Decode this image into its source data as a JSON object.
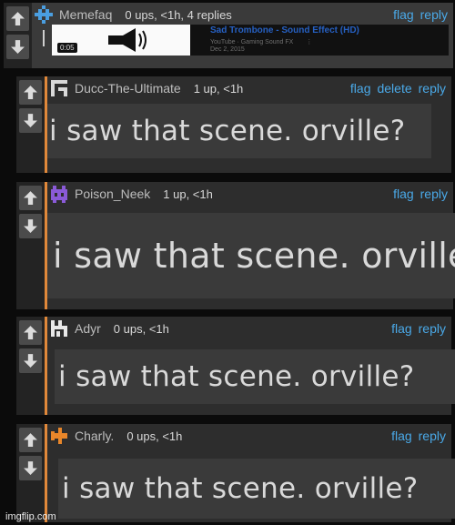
{
  "vote": {
    "up_label": "upvote",
    "down_label": "downvote"
  },
  "comments": [
    {
      "user": "Memefaq",
      "meta": "0 ups, <1h, 4 replies",
      "links": [
        "flag",
        "reply"
      ],
      "avatar_color": "#4a9ee0",
      "embed": {
        "duration": "0:05",
        "title": "Sad Trombone - Sound Effect (HD)",
        "channel": "YouTube · Gaming Sound FX",
        "date": "Dec 2, 2015",
        "menu": "⋮"
      }
    },
    {
      "user": "Ducc-The-Ultimate",
      "meta": "1 up, <1h",
      "links": [
        "flag",
        "delete",
        "reply"
      ],
      "avatar_color": "#d8d8d8",
      "text": "i saw that scene. orville?"
    },
    {
      "user": "Poison_Neek",
      "meta": "1 up, <1h",
      "links": [
        "flag",
        "reply"
      ],
      "avatar_color": "#8a5ad8",
      "text": "i saw that scene. orville?"
    },
    {
      "user": "Adyr",
      "meta": "0 ups, <1h",
      "links": [
        "flag",
        "reply"
      ],
      "avatar_color": "#e8e8e8",
      "text": "i saw that scene. orville?"
    },
    {
      "user": "Charly.",
      "meta": "0 ups, <1h",
      "links": [
        "flag",
        "reply"
      ],
      "avatar_color": "#e8862a",
      "text": "i saw that scene. orville?"
    }
  ],
  "watermark": "imgflip.com",
  "colors": {
    "accent": "#e0883a",
    "link": "#4aa9e8",
    "background": "#0b0b0b"
  }
}
